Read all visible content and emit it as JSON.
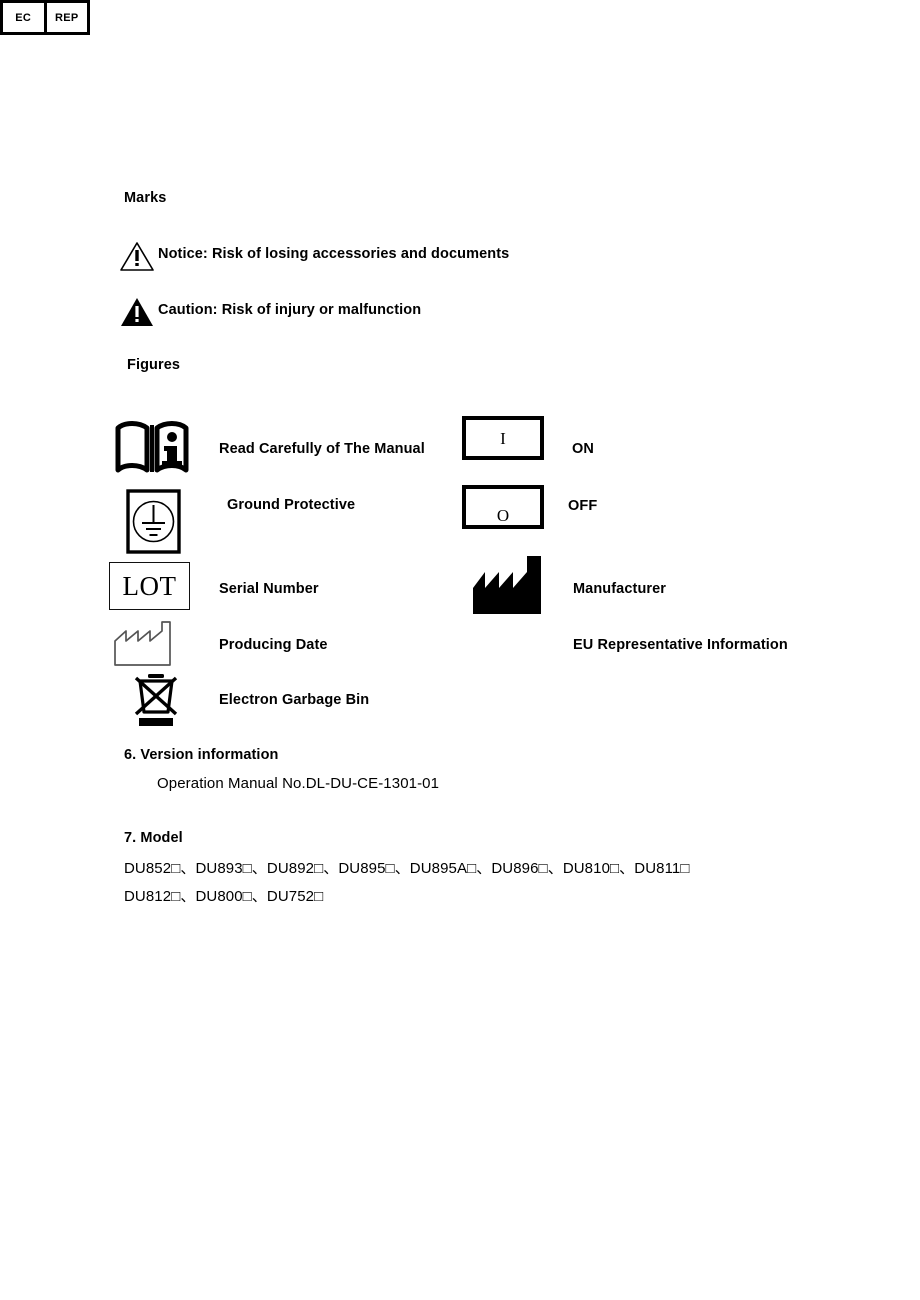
{
  "marks": {
    "heading": "Marks",
    "items": [
      {
        "icon": "warning-triangle-outline-icon",
        "label": "Notice: Risk of losing accessories and documents"
      },
      {
        "icon": "warning-triangle-filled-icon",
        "label": "Caution: Risk of injury or malfunction"
      }
    ]
  },
  "figures": {
    "heading": "Figures",
    "left_column": [
      {
        "icon": "read-manual-icon",
        "label": "Read Carefully of The Manual"
      },
      {
        "icon": "protective-earth-icon",
        "label": "Ground Protective"
      },
      {
        "icon": "lot-icon",
        "icon_text": "LOT",
        "label": "Serial Number"
      },
      {
        "icon": "factory-outline-icon",
        "label": "Producing Date"
      },
      {
        "icon": "weee-crossed-bin-icon",
        "label": "Electron Garbage Bin"
      }
    ],
    "right_column": [
      {
        "icon": "power-on-box-icon",
        "icon_text": "I",
        "label": "ON"
      },
      {
        "icon": "power-off-box-icon",
        "icon_text": "O",
        "label": "OFF"
      },
      {
        "icon": "manufacturer-factory-icon",
        "label": "Manufacturer"
      },
      {
        "icon": "ec-rep-box-icon",
        "icon_text_left": "EC",
        "icon_text_right": "REP",
        "label": "EU Representative Information"
      }
    ]
  },
  "version_section": {
    "heading": "6. Version information",
    "line": "Operation Manual No.DL-DU-CE-1301-01"
  },
  "model_section": {
    "heading": "7. Model",
    "line_1": "DU852□、DU893□、DU892□、DU895□、DU895A□、DU896□、DU810□、DU811□",
    "line_2": "DU812□、DU800□、DU752□"
  },
  "colors": {
    "ink": "#000000",
    "paper": "#ffffff"
  }
}
